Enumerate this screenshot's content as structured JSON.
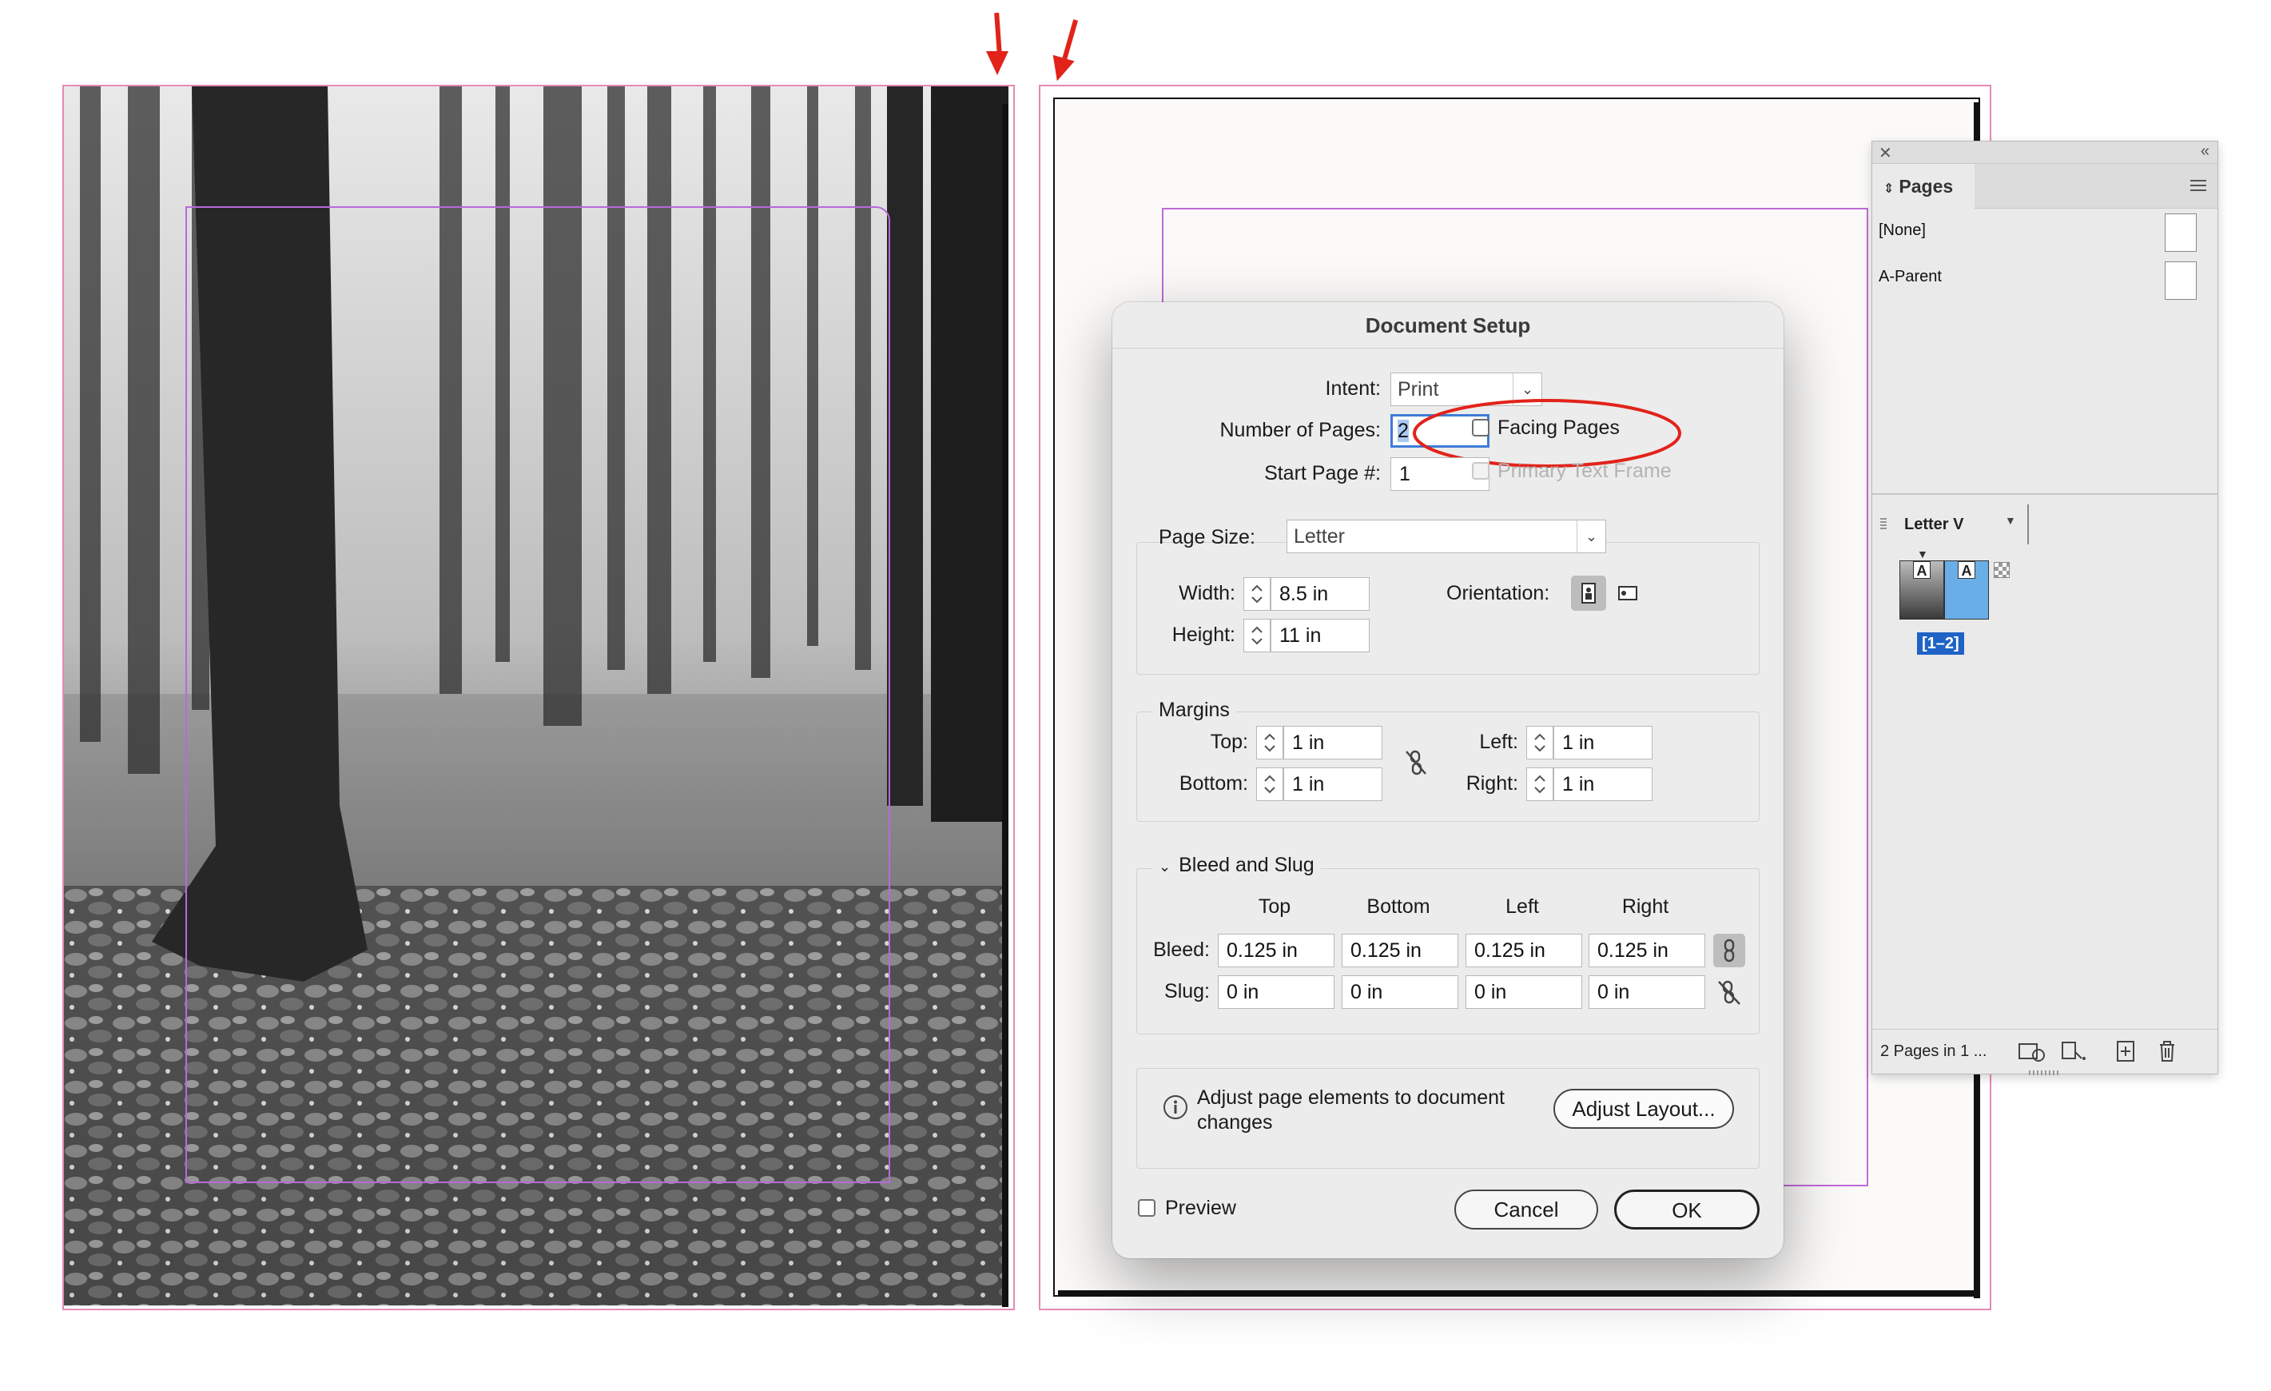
{
  "dialog": {
    "title": "Document Setup",
    "intent_label": "Intent:",
    "intent_value": "Print",
    "num_pages_label": "Number of Pages:",
    "num_pages_value": "2",
    "start_page_label": "Start Page #:",
    "start_page_value": "1",
    "facing_pages_label": "Facing Pages",
    "facing_pages_checked": false,
    "primary_text_frame_label": "Primary Text Frame",
    "page_size_label": "Page Size:",
    "page_size_value": "Letter",
    "width_label": "Width:",
    "width_value": "8.5 in",
    "height_label": "Height:",
    "height_value": "11 in",
    "orientation_label": "Orientation:",
    "margins_title": "Margins",
    "top_label": "Top:",
    "top_value": "1 in",
    "bottom_label": "Bottom:",
    "bottom_value": "1 in",
    "left_label": "Left:",
    "left_value": "1 in",
    "right_label": "Right:",
    "right_value": "1 in",
    "bleed_slug_title": "Bleed and Slug",
    "col_top": "Top",
    "col_bottom": "Bottom",
    "col_left": "Left",
    "col_right": "Right",
    "bleed_label": "Bleed:",
    "bleed_values": [
      "0.125 in",
      "0.125 in",
      "0.125 in",
      "0.125 in"
    ],
    "slug_label": "Slug:",
    "slug_values": [
      "0 in",
      "0 in",
      "0 in",
      "0 in"
    ],
    "adjust_text": "Adjust page elements to document changes",
    "adjust_button": "Adjust Layout...",
    "preview_label": "Preview",
    "cancel_button": "Cancel",
    "ok_button": "OK"
  },
  "pages_panel": {
    "tab_label": "Pages",
    "parents": [
      "[None]",
      "A-Parent"
    ],
    "page_size_menu": "Letter V",
    "spread_label": "[1–2]",
    "page_prefix": "A",
    "status_text": "2 Pages in 1 ..."
  },
  "colors": {
    "annotation_red": "#e2231a",
    "bleed_guide": "#e58ab6",
    "margin_guide": "#b86ad9",
    "selection_blue": "#1f63c6",
    "page_thumb_blue": "#6aaee8"
  }
}
